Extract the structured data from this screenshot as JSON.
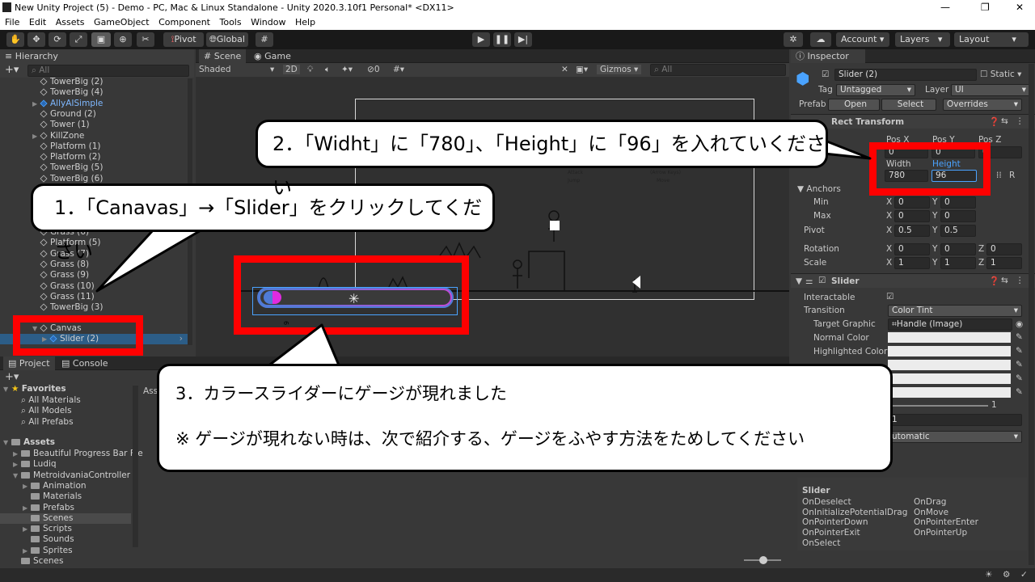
{
  "titlebar": {
    "title": "New Unity Project (5) - Demo - PC, Mac & Linux Standalone - Unity 2020.3.10f1 Personal* <DX11>",
    "min": "—",
    "max": "❐",
    "close": "✕"
  },
  "menu": [
    "File",
    "Edit",
    "Assets",
    "GameObject",
    "Component",
    "Tools",
    "Window",
    "Help"
  ],
  "toolbar": {
    "pivot": "Pivot",
    "global": "Global",
    "account": "Account",
    "layers": "Layers",
    "layout": "Layout"
  },
  "hierarchy": {
    "tab": "Hierarchy",
    "search_placeholder": "All",
    "items": [
      {
        "label": "TowerBig (2)",
        "blue": false,
        "expander": false
      },
      {
        "label": "TowerBig (4)",
        "blue": false,
        "expander": false
      },
      {
        "label": "AllyAISimple",
        "blue": true,
        "expander": true
      },
      {
        "label": "Ground (2)",
        "blue": false,
        "expander": false
      },
      {
        "label": "Tower (1)",
        "blue": false,
        "expander": false
      },
      {
        "label": "KillZone",
        "blue": false,
        "expander": true
      },
      {
        "label": "Platform (1)",
        "blue": false,
        "expander": false
      },
      {
        "label": "Platform (2)",
        "blue": false,
        "expander": false
      },
      {
        "label": "TowerBig (5)",
        "blue": false,
        "expander": false
      },
      {
        "label": "TowerBig (6)",
        "blue": false,
        "expander": false
      }
    ],
    "items2": [
      {
        "label": "Grass (6)"
      },
      {
        "label": "Platform (5)"
      },
      {
        "label": "Grass (7)"
      },
      {
        "label": "Grass (8)"
      },
      {
        "label": "Grass (9)"
      },
      {
        "label": "Grass (10)"
      },
      {
        "label": "Grass (11)"
      },
      {
        "label": "TowerBig (3)"
      }
    ],
    "canvas": "Canvas",
    "slider": "Slider (2)"
  },
  "scene": {
    "tab_scene": "Scene",
    "tab_game": "Game",
    "shading": "Shaded",
    "mode2d": "2D",
    "gizmos": "Gizmos",
    "search_placeholder": "All",
    "zero": "0",
    "slider_label": "6"
  },
  "game_labels": {
    "attack": "Attack",
    "jump": "Jump",
    "arrow": "(Arrow Keys)",
    "move": "Move"
  },
  "project": {
    "tab_project": "Project",
    "tab_console": "Console",
    "assets_crumb": "Ass",
    "favorites": "Favorites",
    "fav_items": [
      "All Materials",
      "All Models",
      "All Prefabs"
    ],
    "assets": "Assets",
    "asset_items": [
      {
        "label": "Beautiful Progress Bar Fre",
        "indent": 1,
        "exp": true
      },
      {
        "label": "Ludiq",
        "indent": 1,
        "exp": true
      },
      {
        "label": "MetroidvaniaController",
        "indent": 1,
        "exp": true,
        "open": true
      },
      {
        "label": "Animation",
        "indent": 2,
        "exp": true
      },
      {
        "label": "Materials",
        "indent": 2,
        "exp": false
      },
      {
        "label": "Prefabs",
        "indent": 2,
        "exp": true
      },
      {
        "label": "Scenes",
        "indent": 2,
        "exp": false,
        "sel": true
      },
      {
        "label": "Scripts",
        "indent": 2,
        "exp": true
      },
      {
        "label": "Sounds",
        "indent": 2,
        "exp": false
      },
      {
        "label": "Sprites",
        "indent": 2,
        "exp": true
      },
      {
        "label": "Scenes",
        "indent": 1,
        "exp": false
      }
    ]
  },
  "inspector": {
    "tab": "Inspector",
    "name": "Slider (2)",
    "static": "Static",
    "tag_label": "Tag",
    "tag": "Untagged",
    "layer_label": "Layer",
    "layer": "UI",
    "prefab_label": "Prefab",
    "open": "Open",
    "select": "Select",
    "overrides": "Overrides",
    "rect": "Rect Transform",
    "posx": "Pos X",
    "posy": "Pos Y",
    "posz": "Pos Z",
    "posx_val": "0",
    "posy_val": "0",
    "posz_val": "0",
    "width_label": "Width",
    "height_label": "Height",
    "width": "780",
    "height": "96",
    "anchors": "Anchors",
    "min": "Min",
    "max": "Max",
    "pivot": "Pivot",
    "x": "X",
    "y": "Y",
    "z": "Z",
    "min_x": "0",
    "min_y": "0",
    "max_x": "0",
    "max_y": "0",
    "pivot_x": "0.5",
    "pivot_y": "0.5",
    "rotation": "Rotation",
    "rot_x": "0",
    "rot_y": "0",
    "rot_z": "0",
    "scale": "Scale",
    "scale_x": "1",
    "scale_y": "1",
    "scale_z": "1",
    "slider_comp": "Slider",
    "interactable": "Interactable",
    "transition": "Transition",
    "transition_val": "Color Tint",
    "target_graphic": "Target Graphic",
    "target_val": "Handle (Image)",
    "normal": "Normal Color",
    "highlighted": "Highlighted Color",
    "val_one": "1",
    "val_one2": "1",
    "automatic": "utomatic",
    "events_title": "Slider",
    "events_left": [
      "OnDeselect",
      "OnInitializePotentialDrag",
      "OnPointerDown",
      "OnPointerExit",
      "OnSelect"
    ],
    "events_right": [
      "OnDrag",
      "OnMove",
      "OnPointerEnter",
      "OnPointerUp"
    ]
  },
  "callouts": {
    "c1": "1．「Canavas」→「Slider」をクリックしてください",
    "c2": "2．「Widht」に「780」、「Height」に「96」を入れていください",
    "c3_line1": "3．カラースライダーにゲージが現れました",
    "c3_line2": "※ ゲージが現れない時は、次で紹介する、ゲージをふやす方法をためしてください"
  }
}
